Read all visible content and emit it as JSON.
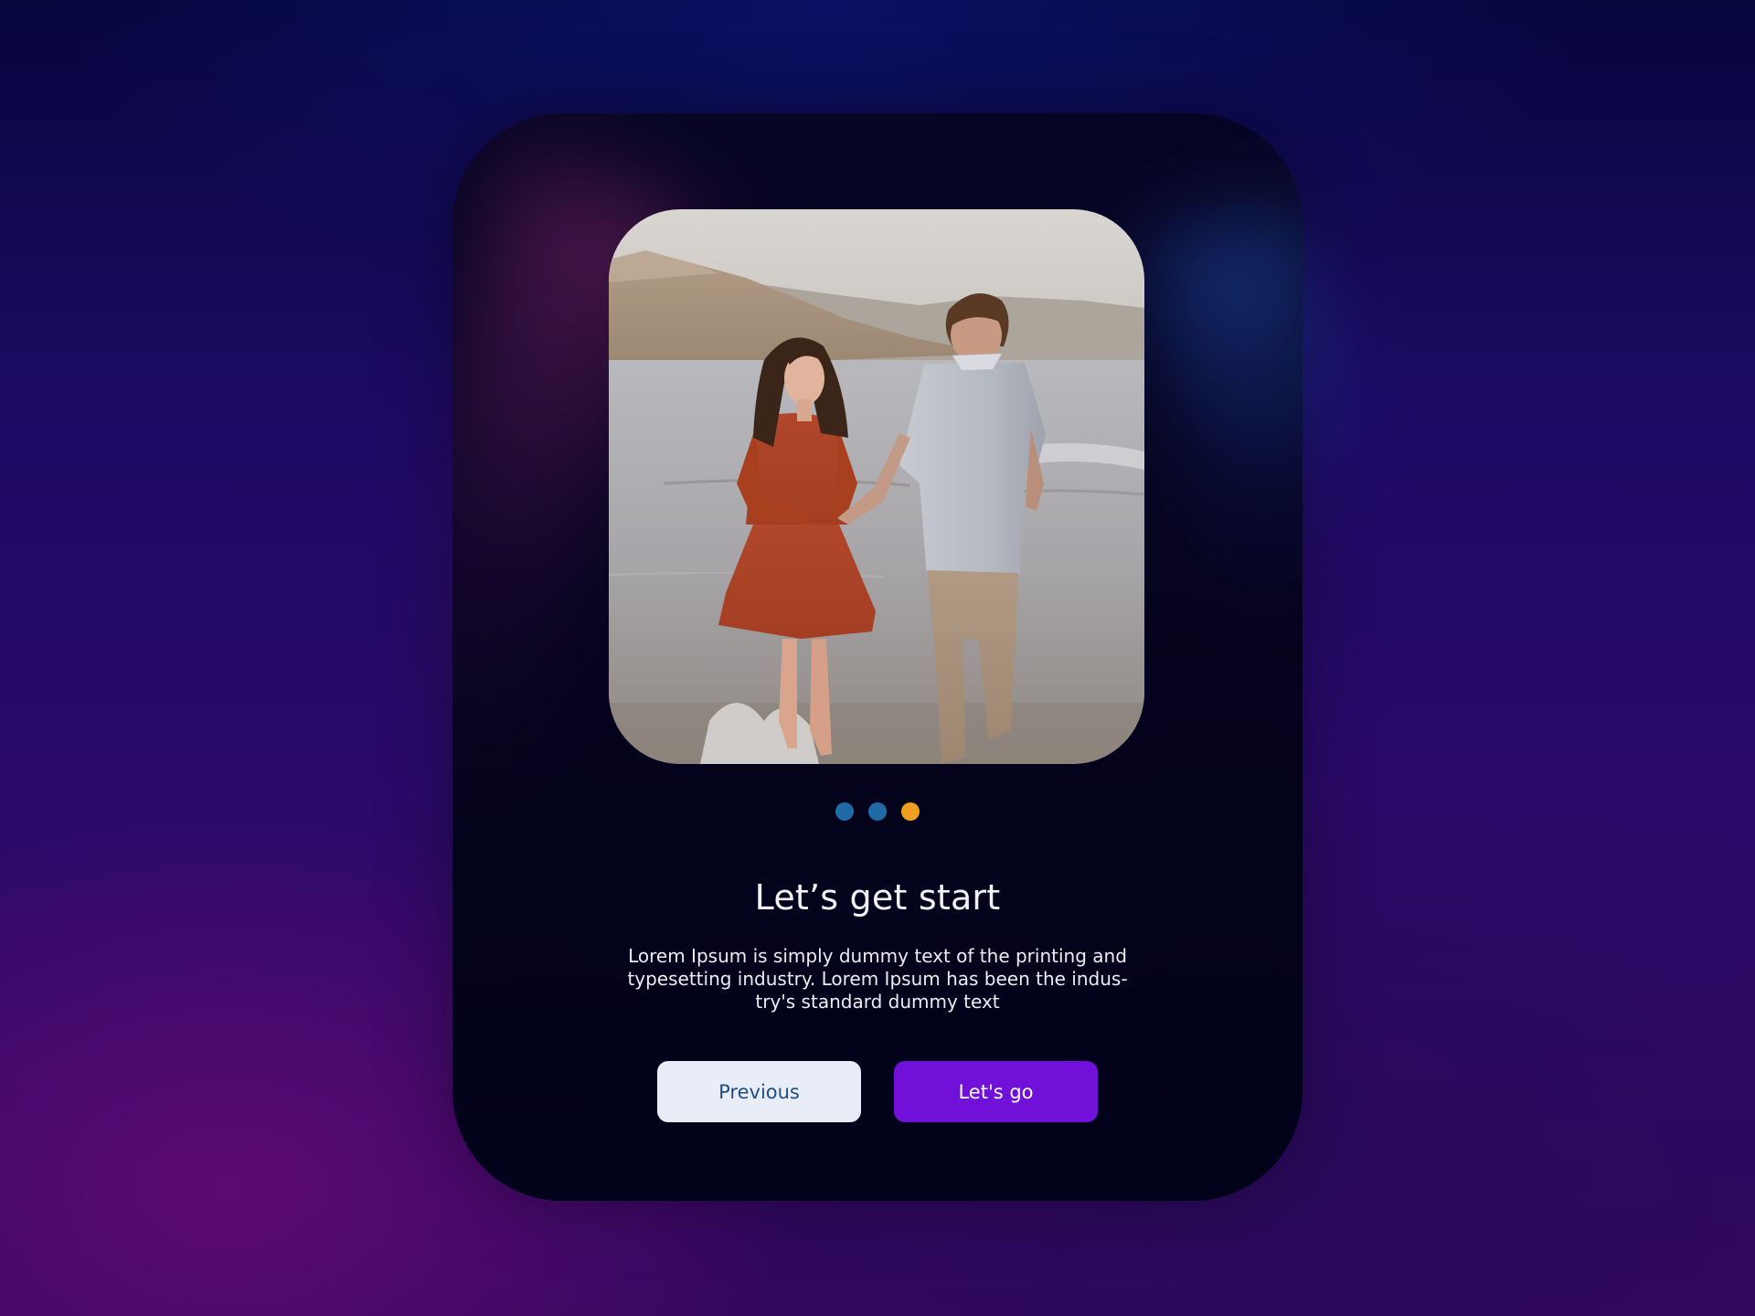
{
  "onboarding": {
    "title": "Let’s get start",
    "description": "Lorem Ipsum is simply dummy text of the printing and typesetting industry. Lorem Ipsum has been the indus-try's standard dummy text",
    "pagination": {
      "total": 3,
      "active_index": 2,
      "dot_color": "#1f6aa5",
      "active_dot_color": "#f0a020"
    },
    "buttons": {
      "previous_label": "Previous",
      "next_label": "Let's go"
    },
    "colors": {
      "primary_button": "#7010d8",
      "secondary_button": "#e9edf7",
      "card_background": "#05041e"
    }
  }
}
